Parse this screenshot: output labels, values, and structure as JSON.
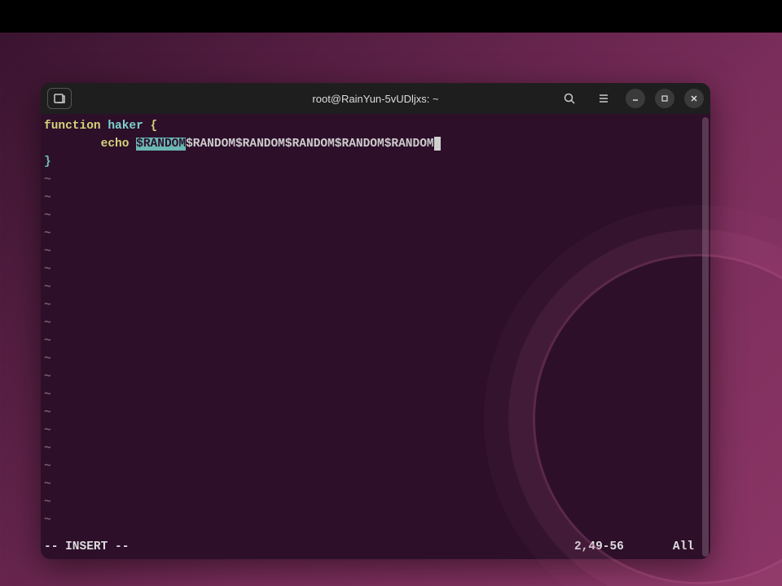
{
  "window": {
    "title": "root@RainYun-5vUDljxs: ~"
  },
  "editor": {
    "lines": {
      "l1_keyword": "function",
      "l1_name": " haker ",
      "l1_brace": "{",
      "l2_indent": "        ",
      "l2_echo": "echo ",
      "l2_random_hl": "$RANDOM",
      "l2_random_rest": "$RANDOM$RANDOM$RANDOM$RANDOM$RANDOM",
      "l3_brace": "}"
    },
    "tilde": "~"
  },
  "status": {
    "mode": "-- INSERT --",
    "position": "2,49-56",
    "scroll": "All"
  }
}
